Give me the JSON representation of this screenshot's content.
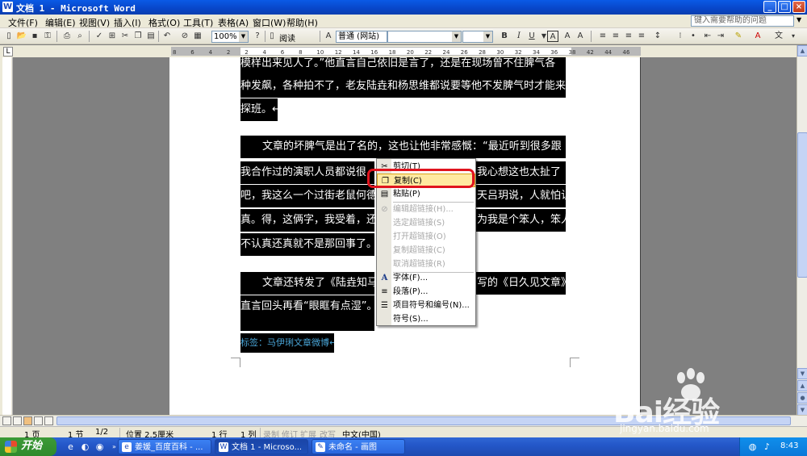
{
  "window": {
    "title": "文档 1 - Microsoft Word",
    "controls": {
      "minimize": "_",
      "maximize": "□",
      "close": "×"
    }
  },
  "menu": {
    "items": [
      "文件(F)",
      "编辑(E)",
      "视图(V)",
      "插入(I)",
      "格式(O)",
      "工具(T)",
      "表格(A)",
      "窗口(W)",
      "帮助(H)"
    ],
    "help_placeholder": "键入需要帮助的问题"
  },
  "toolbar": {
    "zoom": "100%",
    "read_label": "阅读",
    "style": "普通 (网站)",
    "bold": "B",
    "italic": "I",
    "underline": "U",
    "char_border": "A"
  },
  "ruler": {
    "marks": [
      "8",
      "6",
      "4",
      "2",
      "2",
      "4",
      "6",
      "8",
      "10",
      "12",
      "14",
      "16",
      "18",
      "20",
      "22",
      "24",
      "26",
      "28",
      "30",
      "32",
      "34",
      "36",
      "38",
      "42",
      "44",
      "46"
    ]
  },
  "document": {
    "lines": [
      "模样出来见人了。”他直言自己依旧是言了，还是在现场曾不住脾气各",
      "种发飙，各种拍不了，老友陆垚和杨思维都说要等他不发脾气时才能来",
      "探班。↵",
      "文章的坏脾气是出了名的，这也让他非常感慨：“最近听到很多跟",
      "我合作过的演职人员都说很",
      "我心想这也太扯了",
      "吧，我这么一个过街老鼠何德",
      "天吕玥说，人就怕认",
      "真。得，这俩字，我受着，还",
      "为我是个笨人，笨人",
      "不认真还真就不是那回事了。",
      "文章还转发了《陆垚知马",
      "写的《日久见文章》,",
      "直言回头再看“眼眶有点湿”。",
      "标签：马伊琍文章微博↵"
    ]
  },
  "context_menu": {
    "items": [
      {
        "label": "剪切(T)",
        "enabled": true,
        "icon": "scissors-icon"
      },
      {
        "label": "复制(C)",
        "enabled": true,
        "icon": "copy-icon",
        "highlighted": true
      },
      {
        "label": "粘贴(P)",
        "enabled": true,
        "icon": "paste-icon"
      },
      {
        "label": "编辑超链接(H)...",
        "enabled": false
      },
      {
        "label": "选定超链接(S)",
        "enabled": false
      },
      {
        "label": "打开超链接(O)",
        "enabled": false
      },
      {
        "label": "复制超链接(C)",
        "enabled": false
      },
      {
        "label": "取消超链接(R)",
        "enabled": false
      },
      {
        "label": "字体(F)...",
        "enabled": true,
        "icon": "font-icon"
      },
      {
        "label": "段落(P)...",
        "enabled": true,
        "icon": "paragraph-icon"
      },
      {
        "label": "项目符号和编号(N)...",
        "enabled": true,
        "icon": "bullets-icon"
      },
      {
        "label": "符号(S)...",
        "enabled": true
      }
    ]
  },
  "status": {
    "page": "1 页",
    "section": "1 节",
    "page_of": "1/2",
    "position": "位置 2.5厘米",
    "line": "1 行",
    "column": "1 列",
    "rec": "录制",
    "trk": "修订",
    "ext": "扩展",
    "ovr": "改写",
    "language": "中文(中国)"
  },
  "taskbar": {
    "start": "开始",
    "tasks": [
      "姜媛_百度百科 - ...",
      "文档 1 - Microso...",
      "未命名 - 画图"
    ],
    "clock": "8:43"
  },
  "watermark": {
    "brand": "Bai经验",
    "url": "jingyan.baidu.com"
  },
  "colors": {
    "titlebar": "#0846c8",
    "selection": "#000000",
    "highlight_border": "#e0141e",
    "start_button": "#3c9a37"
  }
}
